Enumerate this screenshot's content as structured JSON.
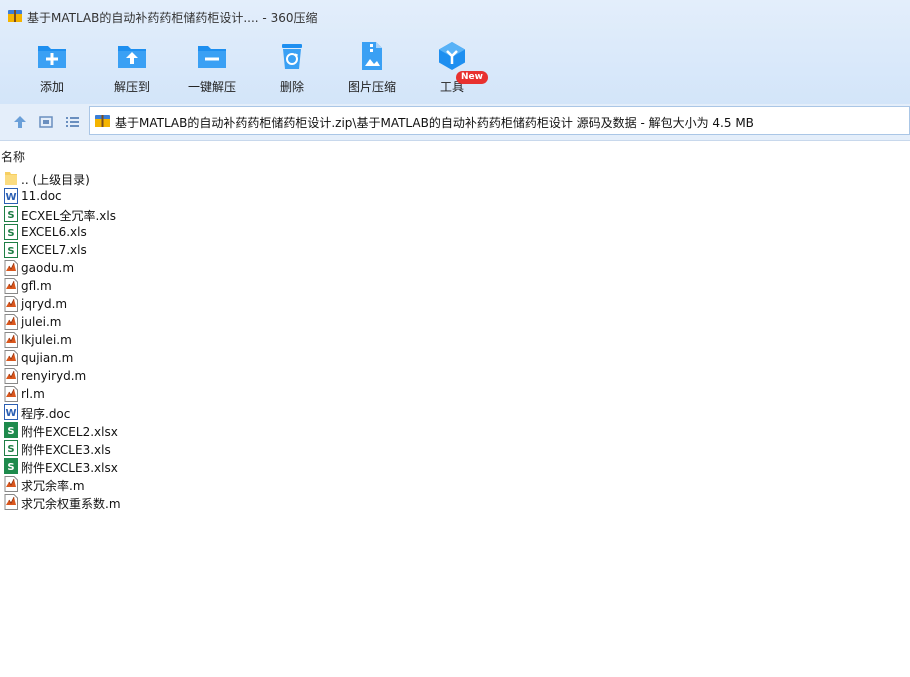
{
  "window": {
    "title": "基于MATLAB的自动补药药柜储药柜设计.... - 360压缩"
  },
  "toolbar": {
    "buttons": [
      {
        "label": "添加",
        "icon": "add-icon"
      },
      {
        "label": "解压到",
        "icon": "extract-to-icon"
      },
      {
        "label": "一键解压",
        "icon": "one-click-extract-icon"
      },
      {
        "label": "删除",
        "icon": "recycle-bin-icon"
      },
      {
        "label": "图片压缩",
        "icon": "image-compress-icon"
      },
      {
        "label": "工具",
        "icon": "tools-icon"
      }
    ],
    "badge": "New"
  },
  "address": {
    "path": "基于MATLAB的自动补药药柜储药柜设计.zip\\基于MATLAB的自动补药药柜储药柜设计 源码及数据 - 解包大小为 4.5 MB"
  },
  "columns": {
    "name": "名称"
  },
  "files": [
    {
      "name": ".. (上级目录)",
      "type": "folder"
    },
    {
      "name": "11.doc",
      "type": "word"
    },
    {
      "name": "ECXEL全冗率.xls",
      "type": "xls"
    },
    {
      "name": "EXCEL6.xls",
      "type": "xls"
    },
    {
      "name": "EXCEL7.xls",
      "type": "xls"
    },
    {
      "name": "gaodu.m",
      "type": "matlab"
    },
    {
      "name": "gfl.m",
      "type": "matlab"
    },
    {
      "name": "jqryd.m",
      "type": "matlab"
    },
    {
      "name": "julei.m",
      "type": "matlab"
    },
    {
      "name": "lkjulei.m",
      "type": "matlab"
    },
    {
      "name": "qujian.m",
      "type": "matlab"
    },
    {
      "name": "renyiryd.m",
      "type": "matlab"
    },
    {
      "name": "rl.m",
      "type": "matlab"
    },
    {
      "name": "程序.doc",
      "type": "word"
    },
    {
      "name": "附件EXCEL2.xlsx",
      "type": "xlsx"
    },
    {
      "name": "附件EXCLE3.xls",
      "type": "xls"
    },
    {
      "name": "附件EXCLE3.xlsx",
      "type": "xlsx"
    },
    {
      "name": "求冗余率.m",
      "type": "matlab"
    },
    {
      "name": "求冗余权重系数.m",
      "type": "matlab"
    }
  ]
}
